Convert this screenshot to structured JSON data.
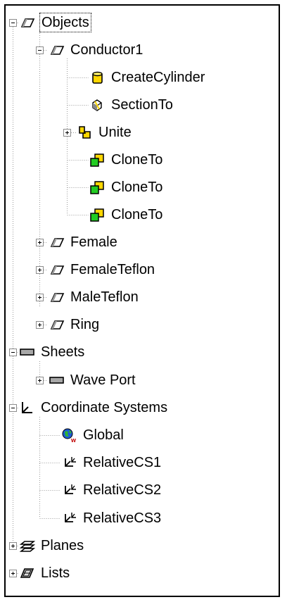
{
  "tree": {
    "objects": {
      "label": "Objects",
      "conductor1": {
        "label": "Conductor1",
        "children": [
          "CreateCylinder",
          "SectionTo",
          "Unite",
          "CloneTo",
          "CloneTo",
          "CloneTo"
        ]
      },
      "others": [
        "Female",
        "FemaleTeflon",
        "MaleTeflon",
        "Ring"
      ]
    },
    "sheets": {
      "label": "Sheets",
      "wave_port": "Wave Port"
    },
    "coordinate_systems": {
      "label": "Coordinate Systems",
      "children": [
        "Global",
        "RelativeCS1",
        "RelativeCS2",
        "RelativeCS3"
      ]
    },
    "planes": "Planes",
    "lists": "Lists"
  }
}
